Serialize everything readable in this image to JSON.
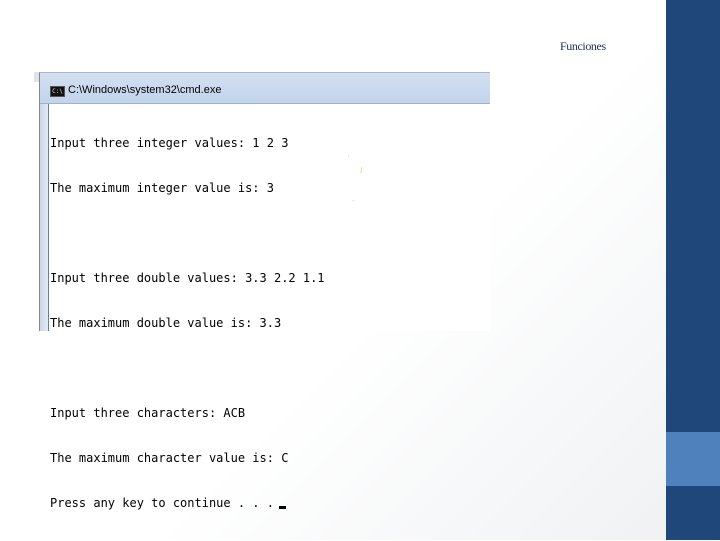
{
  "slide": {
    "title": "Funciones"
  },
  "cmd": {
    "window_title": "C:\\Windows\\system32\\cmd.exe",
    "icon_label": "C:\\",
    "lines": [
      "Input three integer values: 1 2 3",
      "The maximum integer value is: 3",
      "",
      "Input three double values: 3.3 2.2 1.1",
      "The maximum double value is: 3.3",
      "",
      "Input three characters: ACB",
      "The maximum character value is: C",
      "Press any key to continue . . ."
    ]
  },
  "colors": {
    "bar": "#1f477a",
    "accent": "#4f81bd"
  }
}
